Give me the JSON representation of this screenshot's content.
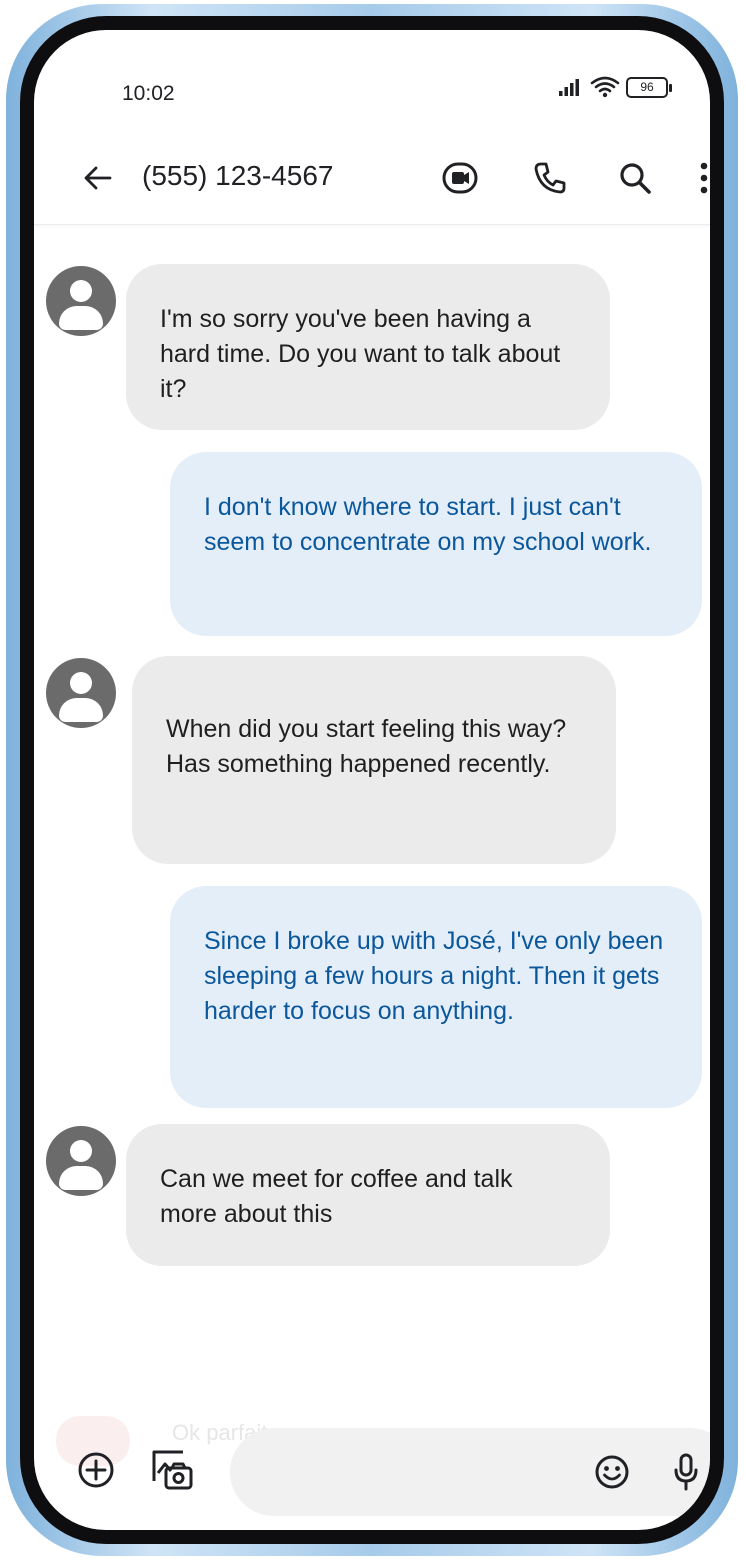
{
  "status_bar": {
    "time": "10:02",
    "battery": "96"
  },
  "app_bar": {
    "contact": "(555) 123-4567"
  },
  "messages": [
    {
      "direction": "incoming",
      "text": "I'm so sorry you've been having a hard time. Do you want to talk about it?"
    },
    {
      "direction": "outgoing",
      "text": "I don't know where to start. I just can't seem to concentrate on my school work."
    },
    {
      "direction": "incoming",
      "text": "When did you start feeling this way? Has something happened recently."
    },
    {
      "direction": "outgoing",
      "text": "Since I broke up with José, I've only been sleeping a few hours a night. Then it gets harder to focus on anything."
    },
    {
      "direction": "incoming",
      "text": "Can we meet for coffee and talk more about this"
    }
  ],
  "composer": {
    "faded_preview": "Ok parfait"
  },
  "colors": {
    "incoming_bubble": "#ebebeb",
    "outgoing_bubble": "#e4eef9",
    "outgoing_text": "#0b579b",
    "avatar": "#6b6b6b",
    "frame": "#a6cbea"
  },
  "icons": {
    "back": "arrow-left-icon",
    "video": "video-call-icon",
    "call": "phone-icon",
    "search": "search-icon",
    "more": "more-vertical-icon",
    "attach": "plus-circle-icon",
    "gallery": "gallery-camera-icon",
    "emoji": "emoji-icon",
    "mic": "mic-icon",
    "signal": "signal-icon",
    "wifi": "wifi-icon",
    "battery": "battery-icon"
  }
}
